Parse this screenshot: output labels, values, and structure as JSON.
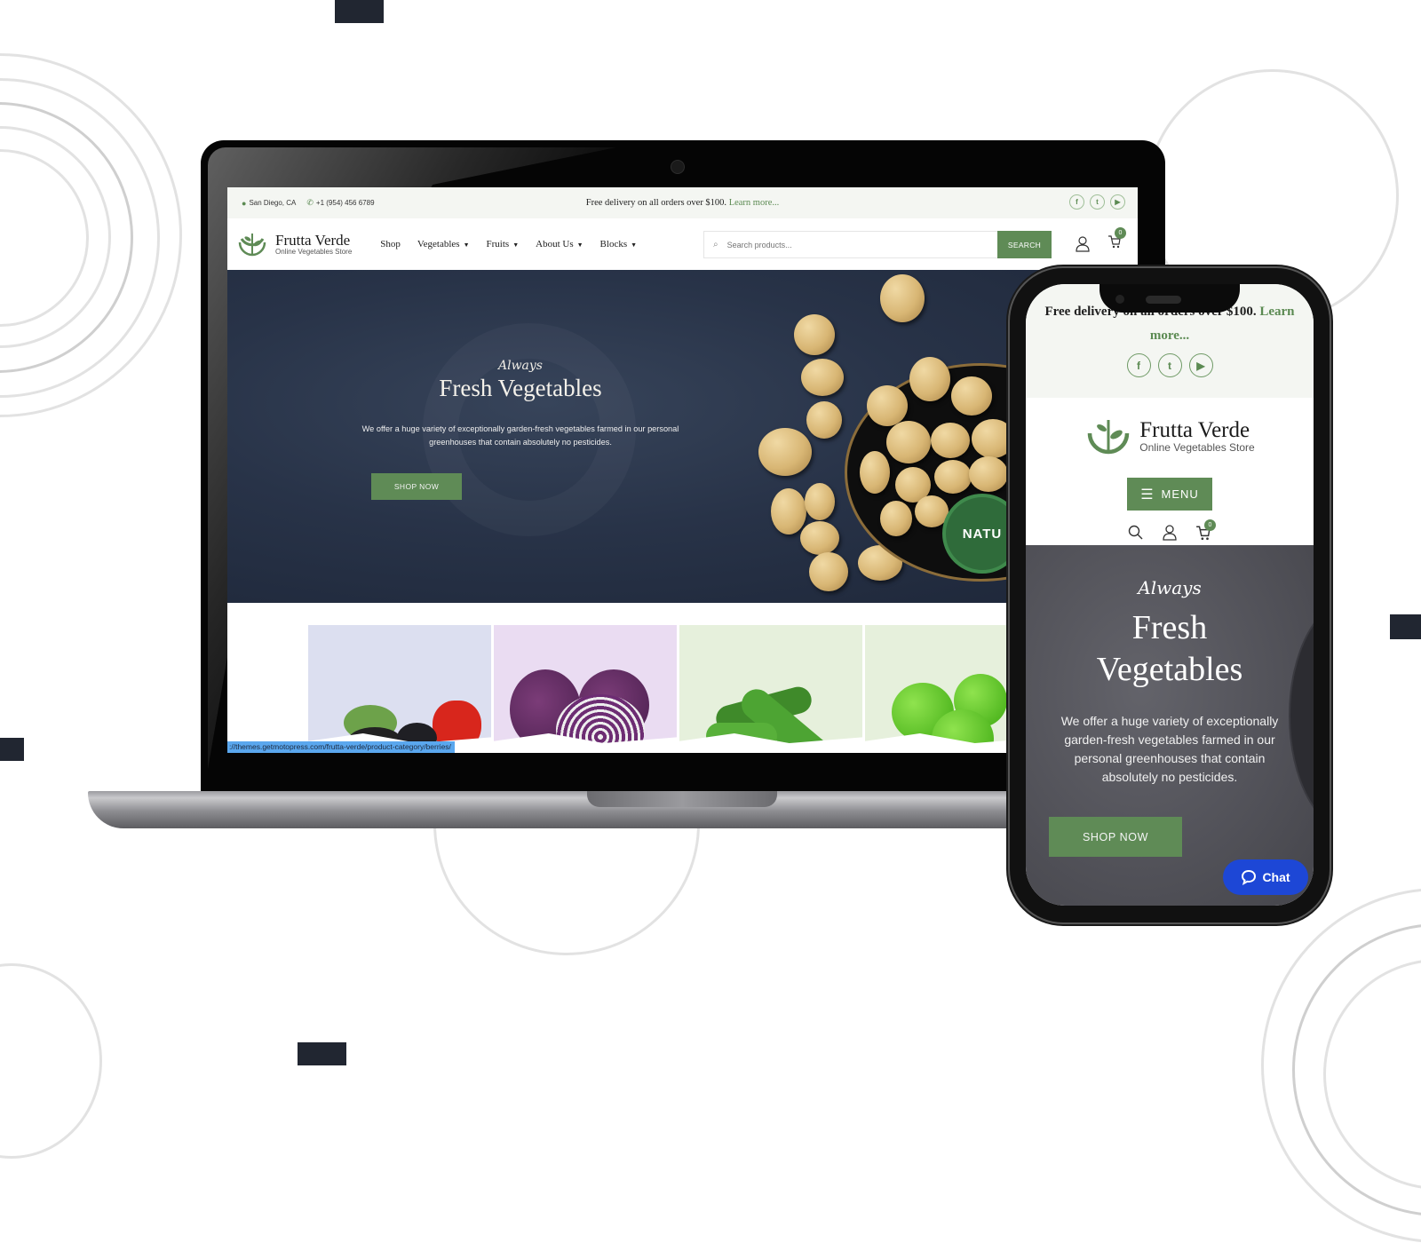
{
  "colors": {
    "brand_green": "#5f8b56",
    "hero_dark": "#283348",
    "chat_blue": "#1d47d6",
    "status_bar_blue": "#5aa7ee"
  },
  "desktop": {
    "topbar": {
      "location": "San Diego, CA",
      "phone": "+1 (954) 456 6789",
      "promo_text": "Free delivery on all orders over $100.",
      "promo_link": "Learn more...",
      "socials": [
        {
          "icon": "facebook-icon",
          "glyph": "f"
        },
        {
          "icon": "twitter-icon",
          "glyph": "t"
        },
        {
          "icon": "youtube-icon",
          "glyph": "▶"
        }
      ]
    },
    "header": {
      "brand_name": "Frutta Verde",
      "brand_tagline": "Online Vegetables Store",
      "menu": [
        {
          "label": "Shop",
          "dropdown": false
        },
        {
          "label": "Vegetables",
          "dropdown": true
        },
        {
          "label": "Fruits",
          "dropdown": true
        },
        {
          "label": "About Us",
          "dropdown": true
        },
        {
          "label": "Blocks",
          "dropdown": true
        }
      ],
      "search_placeholder": "Search products...",
      "search_button": "SEARCH",
      "cart_count": "0"
    },
    "hero": {
      "eyebrow": "Always",
      "title": "Fresh Vegetables",
      "description": "We offer a huge variety of exceptionally garden-fresh vegetables farmed in our personal greenhouses that contain absolutely no pesticides.",
      "cta": "SHOP NOW",
      "seal_text": "NATU"
    },
    "categories": [
      {
        "name": "berries",
        "bg": "#dcdff0"
      },
      {
        "name": "cabbage",
        "bg": "#eadcf2"
      },
      {
        "name": "cucumbers",
        "bg": "#e6f0dc"
      },
      {
        "name": "apples",
        "bg": "#e6f0dc"
      }
    ],
    "status_url": "://themes.getmotopress.com/frutta-verde/product-category/berries/"
  },
  "mobile": {
    "promo_text": "Free delivery on all orders over $100.",
    "promo_link": "Learn more...",
    "brand_name": "Frutta Verde",
    "brand_tagline": "Online Vegetables Store",
    "menu_button": "MENU",
    "cart_count": "0",
    "hero": {
      "eyebrow": "Always",
      "title_line1": "Fresh",
      "title_line2": "Vegetables",
      "description": "We offer a huge variety of exceptionally garden-fresh vegetables farmed in our personal greenhouses that contain absolutely no pesticides.",
      "cta": "SHOP NOW"
    },
    "chat_label": "Chat"
  }
}
